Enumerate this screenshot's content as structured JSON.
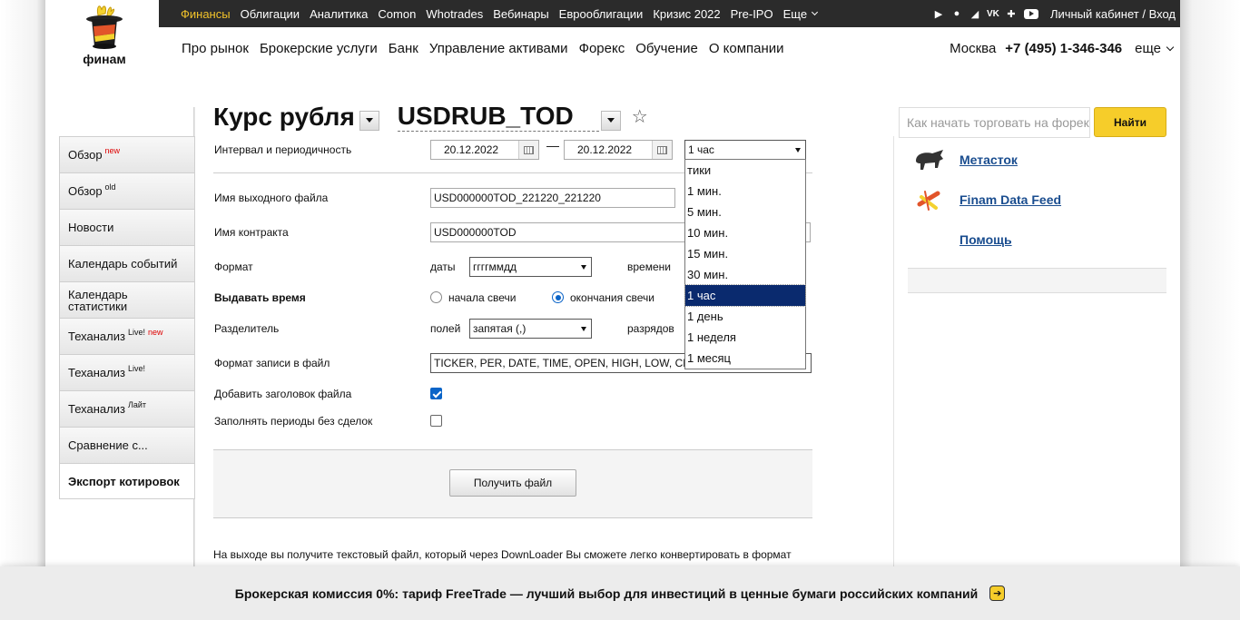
{
  "brand": {
    "name": "финам"
  },
  "topnav": {
    "items": [
      "Финансы",
      "Облигации",
      "Аналитика",
      "Comon",
      "Whotrades",
      "Вебинары",
      "Еврооблигации",
      "Кризис 2022",
      "Pre-IPO"
    ],
    "more": "Еще",
    "account": "Личный кабинет / Вход",
    "social_icons": [
      "google-play-icon",
      "apple-icon",
      "telegram-icon",
      "vk-icon",
      "odnoklassniki-icon",
      "youtube-icon"
    ]
  },
  "mainnav": {
    "items": [
      "Про рынок",
      "Брокерские услуги",
      "Банк",
      "Управление активами",
      "Форекс",
      "Обучение",
      "О компании"
    ],
    "city": "Москва",
    "phone": "+7 (495) 1-346-346",
    "more": "еще"
  },
  "sidebar": {
    "items": [
      {
        "label": "Обзор",
        "sup": "new",
        "sup_red": true
      },
      {
        "label": "Обзор",
        "sup": "old",
        "sup_red": false
      },
      {
        "label": "Новости",
        "sup": "",
        "sup_red": false
      },
      {
        "label": "Календарь событий",
        "sup": "",
        "sup_red": false
      },
      {
        "label": "Календарь статистики",
        "sup": "",
        "sup_red": false
      },
      {
        "label": "Теханализ",
        "sup": "Live!",
        "sup2": "new"
      },
      {
        "label": "Теханализ",
        "sup": "Live!",
        "sup_red": false
      },
      {
        "label": "Теханализ",
        "sup": "Лайт",
        "sup_red": false
      },
      {
        "label": "Сравнение с...",
        "sup": "",
        "sup_red": false
      },
      {
        "label": "Экспорт котировок",
        "sup": "",
        "sup_red": false,
        "active": true
      }
    ]
  },
  "page": {
    "title": "Курс рубля",
    "ticker": "USDRUB_TOD"
  },
  "form": {
    "interval_label": "Интервал и периодичность",
    "date_from": "20.12.2022",
    "date_sep": "—",
    "date_to": "20.12.2022",
    "period_value": "1 час",
    "period_options": [
      "тики",
      "1 мин.",
      "5 мин.",
      "10 мин.",
      "15 мин.",
      "30 мин.",
      "1 час",
      "1 день",
      "1 неделя",
      "1 месяц"
    ],
    "period_selected_index": 6,
    "filename_label": "Имя выходного файла",
    "filename_value": "USD000000TOD_221220_221220",
    "contract_label": "Имя контракта",
    "contract_value": "USD000000TOD",
    "format_label": "Формат",
    "dates_label": "даты",
    "dates_value": "ггггммдд",
    "time_label": "времени",
    "give_time_label": "Выдавать время",
    "radio_start": "начала свечи",
    "radio_end": "окончания свечи",
    "separator_label": "Разделитель",
    "fields_label": "полей",
    "fields_value": "запятая (,)",
    "digits_label": "разрядов",
    "record_format_label": "Формат записи в файл",
    "record_format_value": "TICKER, PER, DATE, TIME, OPEN, HIGH, LOW, CLOSE, VOL",
    "add_header_label": "Добавить заголовок файла",
    "add_header_checked": true,
    "fill_periods_label": "Заполнять периоды без сделок",
    "fill_periods_checked": false,
    "get_file_button": "Получить файл",
    "note": "На выходе вы получите текстовый файл, который через DownLoader Вы сможете легко конвертировать в формат"
  },
  "right": {
    "search_placeholder": "Как начать торговать на форекс",
    "search_button": "Найти",
    "links": [
      "Метасток",
      "Finam Data Feed",
      "Помощь"
    ]
  },
  "banner": {
    "text": "Брокерская комиссия 0%: тариф FreeTrade — лучший выбор для инвестиций в ценные бумаги российских компаний"
  },
  "colors": {
    "accent_yellow": "#f6cd2a",
    "topbar": "#2b2b2b",
    "link": "#1a4d8f",
    "selection": "#0a2a6e"
  }
}
